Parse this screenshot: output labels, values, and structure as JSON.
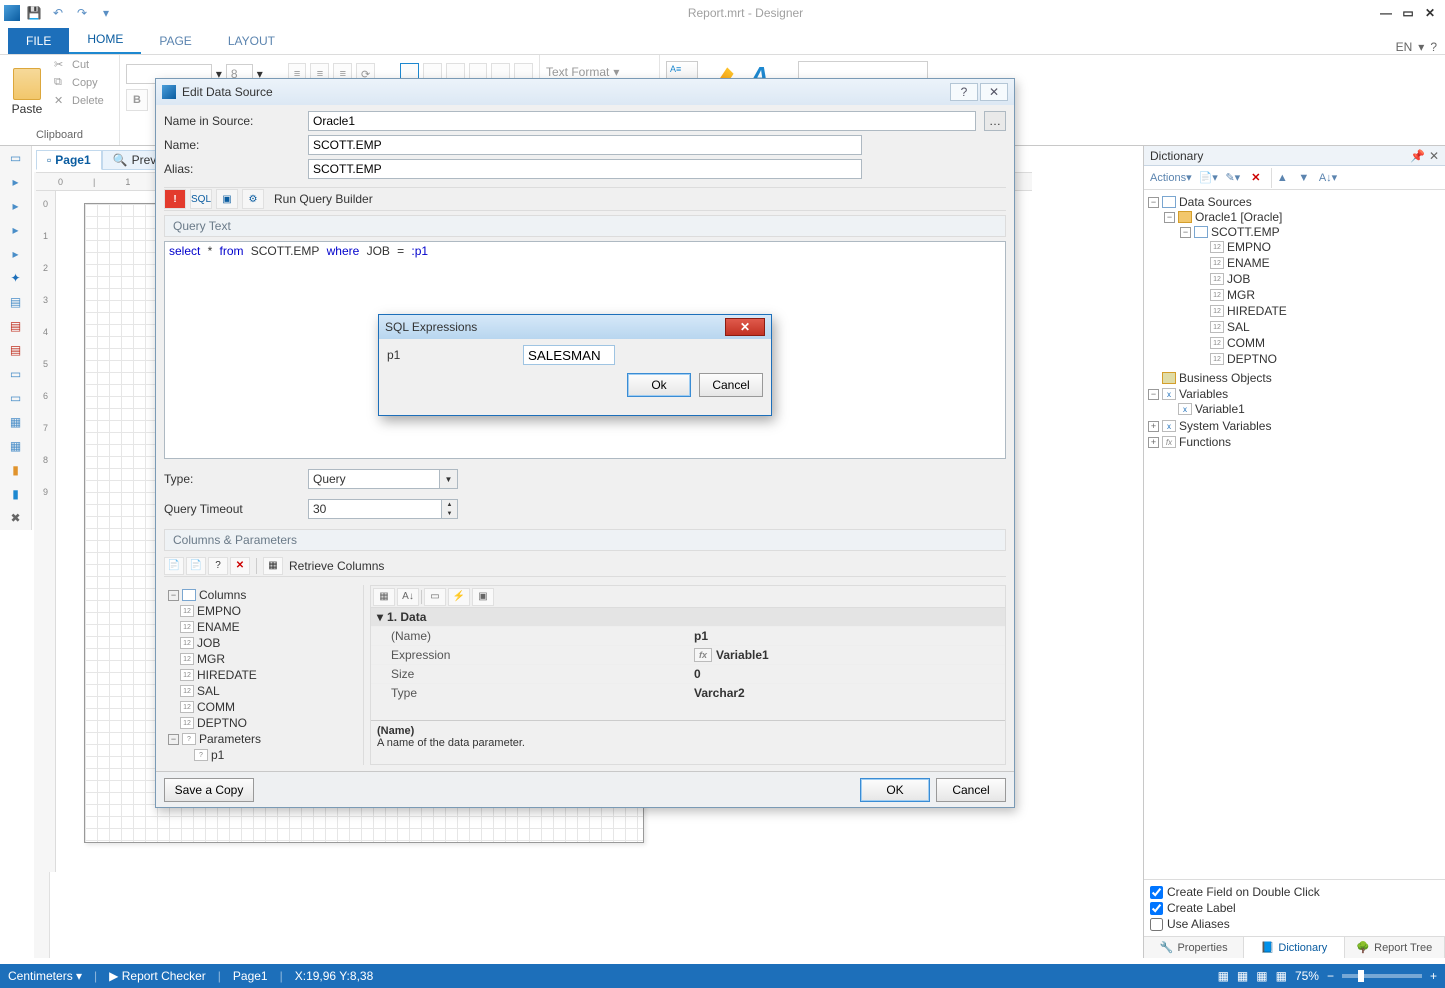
{
  "app": {
    "title": "Report.mrt  - Designer",
    "language": "EN"
  },
  "qat": {
    "save": "💾",
    "undo": "↶",
    "redo": "↷"
  },
  "window_buttons": {
    "min": "—",
    "max": "▭",
    "close": "✕"
  },
  "tabs": {
    "file": "FILE",
    "home": "HOME",
    "page": "PAGE",
    "layout": "LAYOUT"
  },
  "ribbon": {
    "paste": "Paste",
    "cut": "Cut",
    "copy": "Copy",
    "delete": "Delete",
    "clipboard": "Clipboard",
    "font_size": "8",
    "text_format": "Text Format",
    "bold": "B"
  },
  "page_tabs": {
    "page1": "Page1",
    "preview": "Previ"
  },
  "ruler_marks": [
    "0",
    "1",
    "2"
  ],
  "edit_ds": {
    "title": "Edit Data Source",
    "name_in_source_lbl": "Name in Source:",
    "name_in_source": "Oracle1",
    "name_lbl": "Name:",
    "name": "SCOTT.EMP",
    "alias_lbl": "Alias:",
    "alias": "SCOTT.EMP",
    "sql_lbl": "SQL",
    "run_query_builder": "Run Query Builder",
    "query_text_header": "Query Text",
    "query_text_select": "select",
    "query_text_from": "from",
    "query_text_where": "where",
    "query_text_table": "SCOTT.EMP",
    "query_text_col": "JOB",
    "query_text_star": "*",
    "query_text_eq": "=",
    "query_text_param": ":p1",
    "type_lbl": "Type:",
    "type_value": "Query",
    "timeout_lbl": "Query Timeout",
    "timeout_value": "30",
    "cols_params_header": "Columns & Parameters",
    "retrieve_columns": "Retrieve Columns",
    "columns_label": "Columns",
    "columns": [
      "EMPNO",
      "ENAME",
      "JOB",
      "MGR",
      "HIREDATE",
      "SAL",
      "COMM",
      "DEPTNO"
    ],
    "parameters_label": "Parameters",
    "parameters": [
      "p1"
    ],
    "prop_cat": "1. Data",
    "prop_name_lbl": "(Name)",
    "prop_name_val": "p1",
    "prop_expr_lbl": "Expression",
    "prop_expr_val": "Variable1",
    "prop_size_lbl": "Size",
    "prop_size_val": "0",
    "prop_type_lbl": "Type",
    "prop_type_val": "Varchar2",
    "prop_desc_name": "(Name)",
    "prop_desc_text": "A name of the data parameter.",
    "save_copy": "Save a Copy",
    "ok": "OK",
    "cancel": "Cancel"
  },
  "sqlexp": {
    "title": "SQL Expressions",
    "param": "p1",
    "value": "SALESMAN",
    "ok": "Ok",
    "cancel": "Cancel"
  },
  "dict": {
    "title": "Dictionary",
    "actions": "Actions",
    "data_sources": "Data Sources",
    "ds_name": "Oracle1 [Oracle]",
    "table": "SCOTT.EMP",
    "cols": [
      "EMPNO",
      "ENAME",
      "JOB",
      "MGR",
      "HIREDATE",
      "SAL",
      "COMM",
      "DEPTNO"
    ],
    "business_objects": "Business Objects",
    "variables": "Variables",
    "variable1": "Variable1",
    "system_variables": "System Variables",
    "functions": "Functions",
    "chk1": "Create Field on Double Click",
    "chk2": "Create Label",
    "chk3": "Use Aliases",
    "tab_properties": "Properties",
    "tab_dictionary": "Dictionary",
    "tab_report_tree": "Report Tree"
  },
  "status": {
    "units": "Centimeters",
    "report_checker": "Report Checker",
    "page": "Page1",
    "coords": "X:19,96  Y:8,38",
    "zoom": "75%"
  }
}
